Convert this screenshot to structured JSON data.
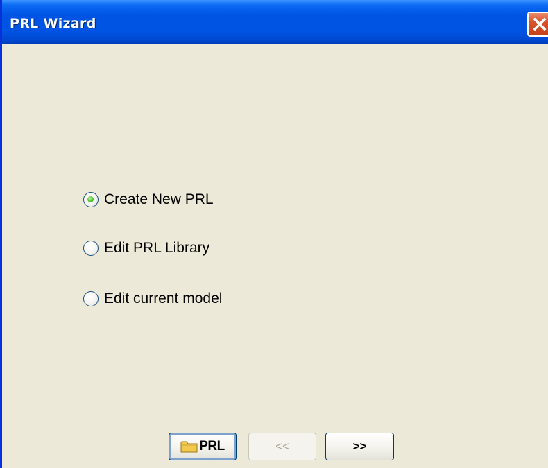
{
  "window": {
    "title": "PRL Wizard",
    "close_icon": "close-x-icon"
  },
  "options": [
    {
      "label": "Create New PRL",
      "checked": true
    },
    {
      "label": "Edit PRL Library",
      "checked": false
    },
    {
      "label": "Edit current model",
      "checked": false
    }
  ],
  "buttons": {
    "prl_label": "PRL",
    "prl_icon": "folder-icon",
    "prev_label": "<<",
    "prev_enabled": false,
    "next_label": ">>",
    "next_enabled": true
  },
  "colors": {
    "titlebar": "#0054E3",
    "background": "#ECE9D8",
    "close_button": "#D8532B",
    "radio_selected": "#52C22E"
  }
}
